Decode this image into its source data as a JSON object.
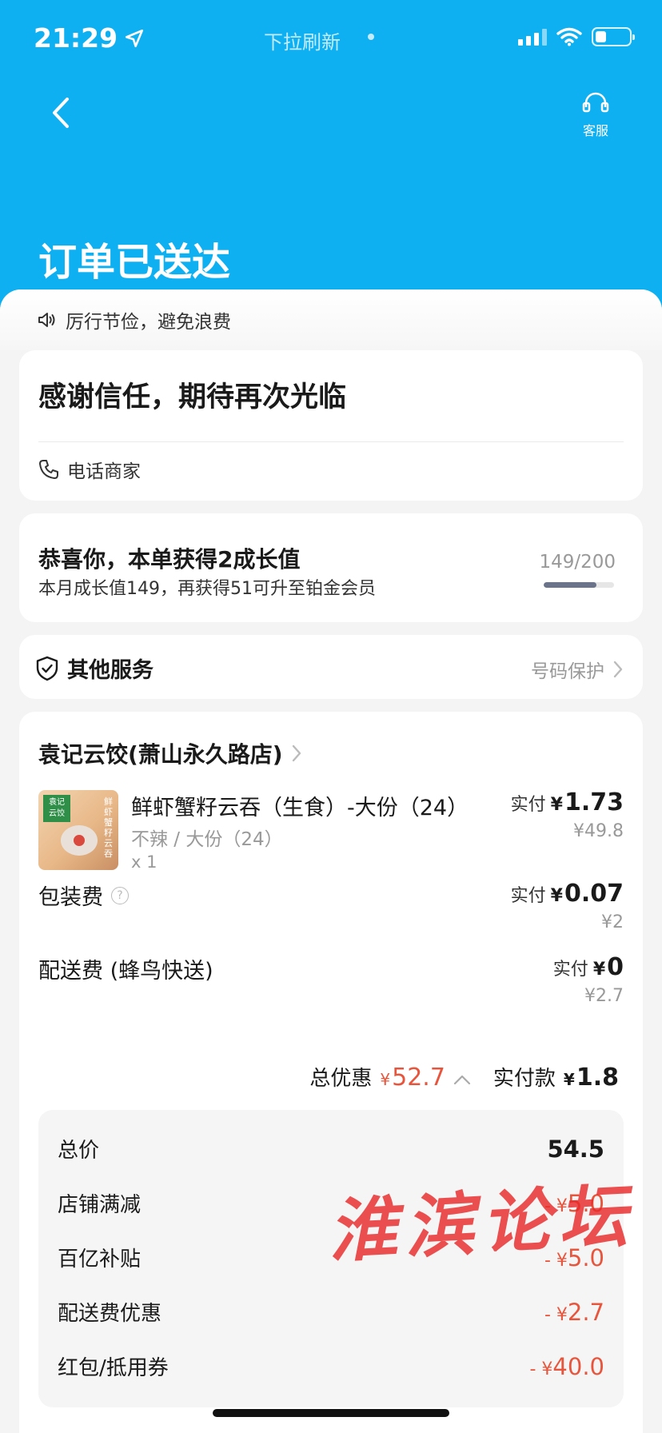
{
  "status_bar": {
    "time": "21:29",
    "pull_refresh": "下拉刷新"
  },
  "header": {
    "service_label": "客服",
    "title": "订单已送达"
  },
  "notice": {
    "text": "厉行节俭，避免浪费"
  },
  "thanks_card": {
    "message": "感谢信任，期待再次光临",
    "call_label": "电话商家"
  },
  "growth_card": {
    "title": "恭喜你，本单获得2成长值",
    "subtitle": "本月成长值149，再获得51可升至铂金会员",
    "progress_text": "149/200",
    "progress_fraction": 0.745
  },
  "service_card": {
    "title": "其他服务",
    "right_label": "号码保护"
  },
  "order": {
    "shop_name": "袁记云饺(萧山永久路店)",
    "item": {
      "name": "鲜虾蟹籽云吞（生食）-大份（24）",
      "spec": "不辣 / 大份（24）",
      "qty": "x 1",
      "paid_label": "实付",
      "paid_amount": "1.73",
      "original_price": "¥49.8",
      "thumb_badge": "袁记云饺",
      "thumb_text": "鲜虾蟹籽云吞"
    },
    "packing": {
      "label": "包装费",
      "paid_label": "实付",
      "paid_amount": "0.07",
      "original_price": "¥2"
    },
    "delivery": {
      "label": "配送费 (蜂鸟快送)",
      "paid_label": "实付",
      "paid_amount": "0",
      "original_price": "¥2.7"
    },
    "summary": {
      "discount_label": "总优惠",
      "discount_amount": "52.7",
      "paid_label": "实付款",
      "paid_amount": "1.8"
    },
    "breakdown": [
      {
        "label": "总价",
        "value": "54.5"
      },
      {
        "label": "店铺满减",
        "value": "5.0"
      },
      {
        "label": "百亿补贴",
        "value": "5.0"
      },
      {
        "label": "配送费优惠",
        "value": "2.7"
      },
      {
        "label": "红包/抵用券",
        "value": "40.0"
      }
    ],
    "yen": "¥",
    "minus_yen": "- ¥"
  },
  "watermark": "淮滨论坛",
  "colors": {
    "brand_blue": "#0fb0f2",
    "discount_red": "#e8553d"
  }
}
